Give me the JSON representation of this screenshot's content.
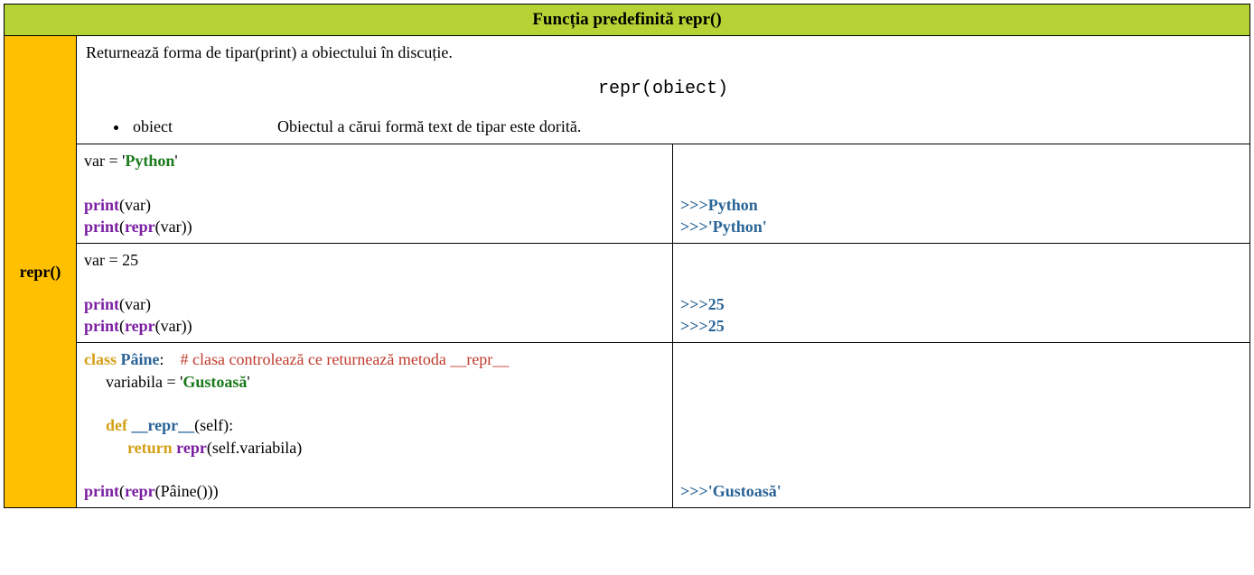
{
  "header": {
    "title": "Funcția predefinită repr()"
  },
  "side": {
    "label": "repr()"
  },
  "description": {
    "text": "Returnează forma de tipar(print) a obiectului în discuție.",
    "signature": "repr(obiect)",
    "param_name": "obiect",
    "param_desc": "Obiectul a cărui formă text de tipar este dorită."
  },
  "ex1": {
    "code": {
      "l1a": "var = '",
      "l1b": "Python",
      "l1c": "'",
      "l2a": "print",
      "l2b": "(var)",
      "l3a": "print",
      "l3b": "(",
      "l3c": "repr",
      "l3d": "(var))"
    },
    "out": {
      "p1": ">>>",
      "v1": "Python",
      "p2": ">>>",
      "v2": "'Python'"
    }
  },
  "ex2": {
    "code": {
      "l1": "var = 25",
      "l2a": "print",
      "l2b": "(var)",
      "l3a": "print",
      "l3b": "(",
      "l3c": "repr",
      "l3d": "(var))"
    },
    "out": {
      "p1": ">>>",
      "v1": "25",
      "p2": ">>>",
      "v2": "25"
    }
  },
  "ex3": {
    "code": {
      "l1a": "class ",
      "l1b": "Pâine",
      "l1c": ":    ",
      "l1d": "# clasa controlează ce returnează metoda __repr__",
      "l2a": "variabila = '",
      "l2b": "Gustoasă",
      "l2c": "'",
      "l3a": "def ",
      "l3b": "__repr__",
      "l3c": "(self):",
      "l4a": "return ",
      "l4b": "repr",
      "l4c": "(self.variabila)",
      "l5a": "print",
      "l5b": "(",
      "l5c": "repr",
      "l5d": "(Pâine()))"
    },
    "out": {
      "p1": ">>>",
      "v1": "'Gustoasă'"
    }
  }
}
